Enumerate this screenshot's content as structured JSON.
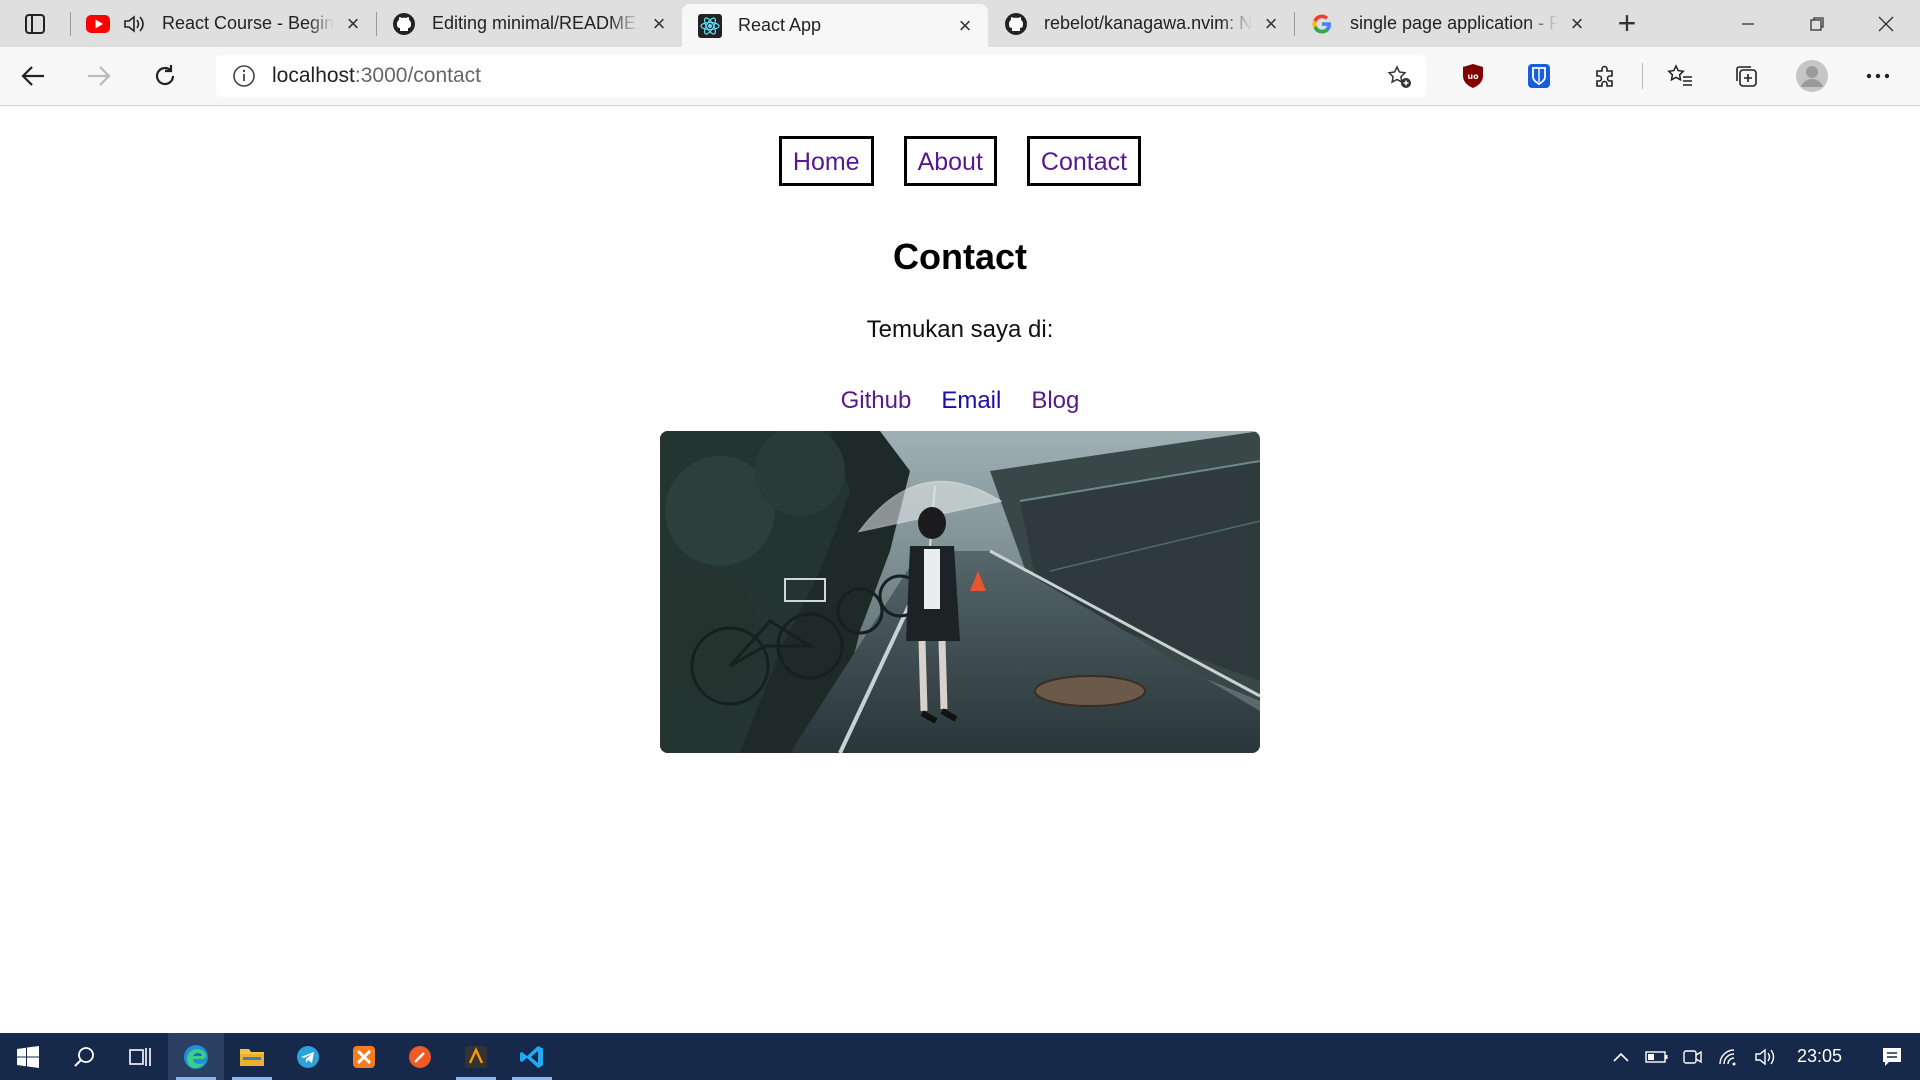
{
  "browser": {
    "tabs": [
      {
        "title": "React Course - Beginner's Tutorial",
        "icon": "youtube-icon",
        "has_audio": true,
        "active": false
      },
      {
        "title": "Editing minimal/README.md",
        "icon": "github-icon",
        "active": false
      },
      {
        "title": "React App",
        "icon": "react-icon",
        "active": true
      },
      {
        "title": "rebelot/kanagawa.nvim: N",
        "icon": "github-icon",
        "active": false
      },
      {
        "title": "single page application - P",
        "icon": "google-icon",
        "active": false
      }
    ],
    "address": {
      "host": "localhost",
      "path": ":3000/contact"
    }
  },
  "page": {
    "nav": [
      {
        "label": "Home"
      },
      {
        "label": "About"
      },
      {
        "label": "Contact"
      }
    ],
    "heading": "Contact",
    "subtitle": "Temukan saya di:",
    "links": [
      {
        "label": "Github",
        "state": "visited"
      },
      {
        "label": "Email",
        "state": "unvisited"
      },
      {
        "label": "Blog",
        "state": "visited"
      }
    ],
    "image": {
      "icon": "anime-girl-umbrella-rainy-street-image"
    }
  },
  "taskbar": {
    "apps": [
      {
        "icon": "edge-icon",
        "active": true
      },
      {
        "icon": "file-explorer-icon",
        "active": false
      },
      {
        "icon": "telegram-icon",
        "active": false
      },
      {
        "icon": "xampp-icon",
        "active": false
      },
      {
        "icon": "postman-icon",
        "active": false
      },
      {
        "icon": "sublime-text-icon",
        "active": false
      },
      {
        "icon": "vscode-icon",
        "active": false
      }
    ],
    "clock": "23:05"
  },
  "colors": {
    "link_visited": "#551a8b",
    "link_unvisited": "#1a0dab",
    "taskbar": "#16294a"
  }
}
